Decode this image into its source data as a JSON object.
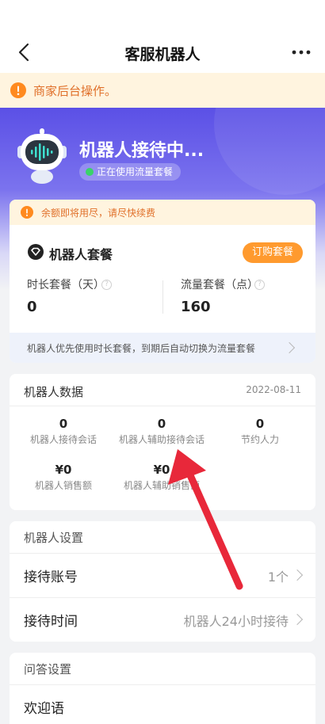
{
  "nav": {
    "title": "客服机器人",
    "back_icon": "chevron-left-icon",
    "more_icon": "more-dots-icon"
  },
  "notice": {
    "text": "商家后台操作。",
    "icon": "warning-circle-icon",
    "color": "#e0702a"
  },
  "hero": {
    "title": "机器人接待中...",
    "status": "正在使用流量套餐",
    "status_color": "#3ad36a"
  },
  "package": {
    "alert": "余额即将用尽，请尽快续费",
    "title": "机器人套餐",
    "order_button": "订购套餐",
    "time_label": "时长套餐（天）",
    "time_value": "0",
    "flow_label": "流量套餐（点）",
    "flow_value": "160",
    "footer": "机器人优先使用时长套餐，到期后自动切换为流量套餐",
    "accent": "#ff9a2e"
  },
  "data": {
    "title": "机器人数据",
    "date": "2022-08-11",
    "metrics": [
      {
        "value": "0",
        "label": "机器人接待会话"
      },
      {
        "value": "0",
        "label": "机器人辅助接待会话"
      },
      {
        "value": "0",
        "label": "节约人力"
      },
      {
        "value": "¥0",
        "label": "机器人销售额"
      },
      {
        "value": "¥0",
        "label": "机器人辅助销售额"
      }
    ]
  },
  "settings": {
    "title": "机器人设置",
    "rows": [
      {
        "label": "接待账号",
        "value": "1个"
      },
      {
        "label": "接待时间",
        "value": "机器人24小时接待"
      }
    ]
  },
  "qa": {
    "title": "问答设置",
    "rows": [
      {
        "label": "欢迎语"
      }
    ]
  },
  "annotation": {
    "arrow_color": "#e8283a"
  }
}
